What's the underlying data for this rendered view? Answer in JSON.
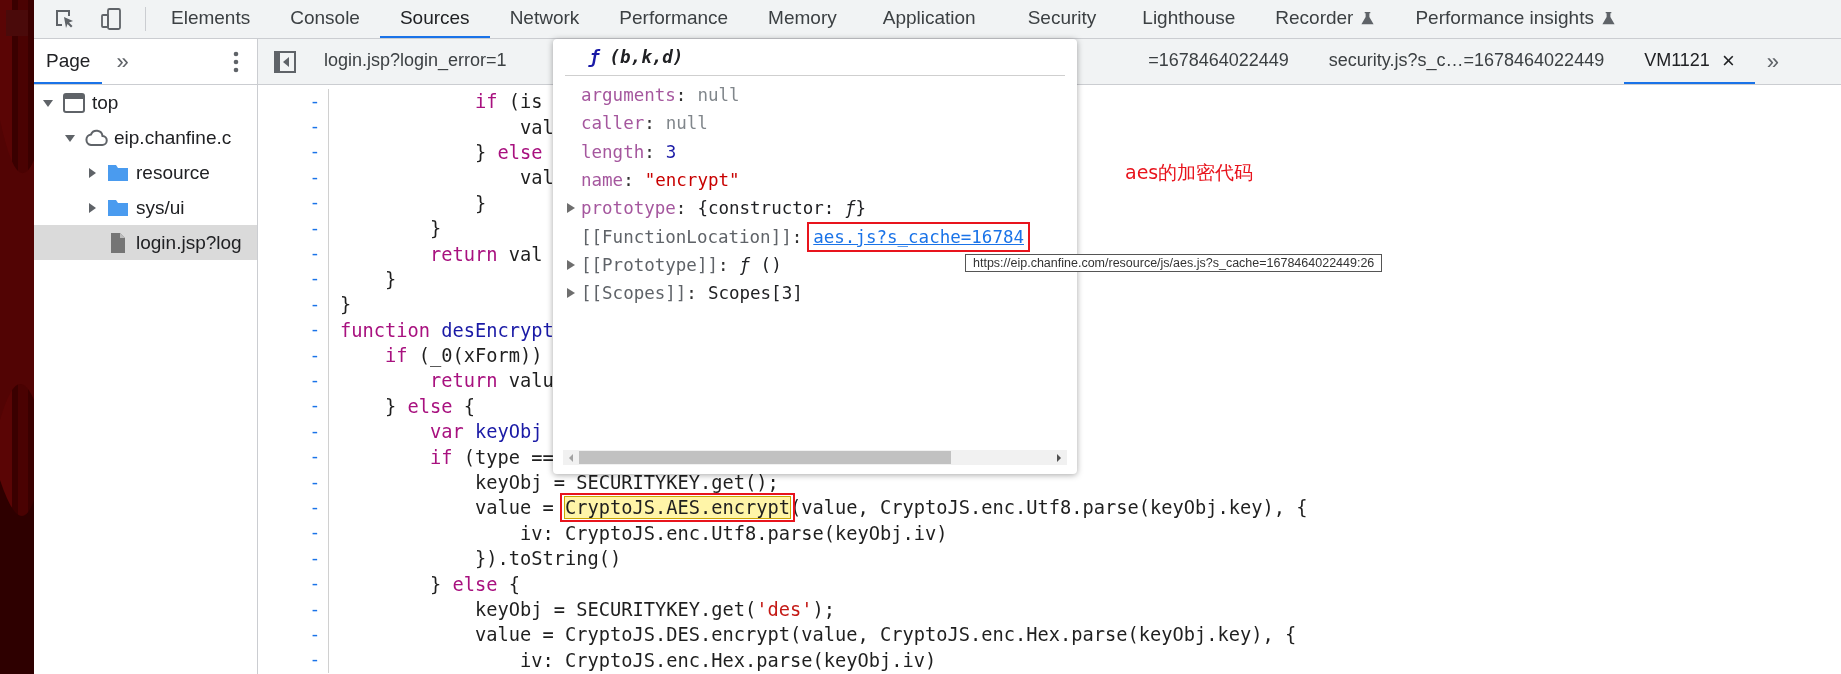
{
  "panel_tabs": [
    {
      "label": "Elements",
      "selected": false,
      "experimental": false
    },
    {
      "label": "Console",
      "selected": false,
      "experimental": false
    },
    {
      "label": "Sources",
      "selected": true,
      "experimental": false
    },
    {
      "label": "Network",
      "selected": false,
      "experimental": false
    },
    {
      "label": "Performance",
      "selected": false,
      "experimental": false
    },
    {
      "label": "Memory",
      "selected": false,
      "experimental": false
    },
    {
      "label": "Application",
      "selected": false,
      "experimental": false
    },
    {
      "label": "Security",
      "selected": false,
      "experimental": false
    },
    {
      "label": "Lighthouse",
      "selected": false,
      "experimental": false
    },
    {
      "label": "Recorder",
      "selected": false,
      "experimental": true
    },
    {
      "label": "Performance insights",
      "selected": false,
      "experimental": true
    }
  ],
  "navigator": {
    "tabs": [
      {
        "label": "Page",
        "selected": true
      }
    ],
    "more": "»",
    "tree": [
      {
        "label": "top",
        "kind": "frame",
        "expanded": true,
        "selected": false,
        "children": [
          {
            "label": "eip.chanfine.c",
            "kind": "domain",
            "expanded": true,
            "selected": false,
            "children": [
              {
                "label": "resource",
                "kind": "folder",
                "expanded": false,
                "selected": false
              },
              {
                "label": "sys/ui",
                "kind": "folder",
                "expanded": false,
                "selected": false
              },
              {
                "label": "login.jsp?log",
                "kind": "file",
                "selected": true
              }
            ]
          }
        ]
      }
    ]
  },
  "editor": {
    "tabs": [
      {
        "label": "login.jsp?login_error=1",
        "selected": false,
        "closable": false
      },
      {
        "label": "=1678464022449",
        "selected": false,
        "closable": false
      },
      {
        "label": "security.js?s_c…=1678464022449",
        "selected": false,
        "closable": false
      },
      {
        "label": "VM1121",
        "selected": true,
        "closable": true,
        "close": "×"
      }
    ],
    "more": "»",
    "lines": [
      {
        "marker": "-",
        "tokens": [
          {
            "kind": "keyword",
            "text": "            if"
          },
          {
            "kind": "plain",
            "text": " (is"
          }
        ]
      },
      {
        "marker": "-",
        "tokens": [
          {
            "kind": "plain",
            "text": "                val"
          }
        ]
      },
      {
        "marker": "-",
        "tokens": [
          {
            "kind": "plain",
            "text": "            }"
          },
          {
            "kind": "keyword",
            "text": " else"
          }
        ]
      },
      {
        "marker": "-",
        "tokens": [
          {
            "kind": "plain",
            "text": "                val"
          }
        ]
      },
      {
        "marker": "-",
        "tokens": [
          {
            "kind": "plain",
            "text": "            }"
          }
        ]
      },
      {
        "marker": "-",
        "tokens": [
          {
            "kind": "plain",
            "text": "        }"
          }
        ]
      },
      {
        "marker": "-",
        "tokens": [
          {
            "kind": "keyword",
            "text": "        return"
          },
          {
            "kind": "plain",
            "text": " val"
          }
        ]
      },
      {
        "marker": "-",
        "tokens": [
          {
            "kind": "plain",
            "text": "    }"
          }
        ]
      },
      {
        "marker": "-",
        "tokens": [
          {
            "kind": "plain",
            "text": "}"
          }
        ]
      },
      {
        "marker": "-",
        "tokens": [
          {
            "kind": "keyword",
            "text": "function"
          },
          {
            "kind": "definition",
            "text": " desEncrypt"
          }
        ]
      },
      {
        "marker": "-",
        "tokens": [
          {
            "kind": "keyword",
            "text": "    if"
          },
          {
            "kind": "plain",
            "text": " (_0(xForm))"
          }
        ]
      },
      {
        "marker": "-",
        "tokens": [
          {
            "kind": "keyword",
            "text": "        return"
          },
          {
            "kind": "plain",
            "text": " valu"
          }
        ]
      },
      {
        "marker": "-",
        "tokens": [
          {
            "kind": "plain",
            "text": "    }"
          },
          {
            "kind": "keyword",
            "text": " else"
          },
          {
            "kind": "plain",
            "text": " {"
          }
        ]
      },
      {
        "marker": "-",
        "tokens": [
          {
            "kind": "keyword",
            "text": "        var"
          },
          {
            "kind": "definition",
            "text": " keyObj"
          }
        ]
      },
      {
        "marker": "-",
        "tokens": [
          {
            "kind": "keyword",
            "text": "        if"
          },
          {
            "kind": "plain",
            "text": " (type =="
          }
        ]
      },
      {
        "marker": "-",
        "tokens": [
          {
            "kind": "plain",
            "text": "            keyObj = SECURITYKEY.get();"
          }
        ]
      },
      {
        "marker": "-",
        "tokens": [
          {
            "kind": "plain",
            "text": "            value ="
          },
          {
            "kind": "highlight",
            "text": "CryptoJS.AES.encrypt"
          },
          {
            "kind": "plain",
            "text": "(value, CryptoJS.enc.Utf8.parse(keyObj.key), {"
          }
        ]
      },
      {
        "marker": "-",
        "tokens": [
          {
            "kind": "plain",
            "text": "                iv: CryptoJS.enc.Utf8.parse(keyObj.iv)"
          }
        ]
      },
      {
        "marker": "-",
        "tokens": [
          {
            "kind": "plain",
            "text": "            }).toString()"
          }
        ]
      },
      {
        "marker": "-",
        "tokens": [
          {
            "kind": "plain",
            "text": "        }"
          },
          {
            "kind": "keyword",
            "text": " else"
          },
          {
            "kind": "plain",
            "text": " {"
          }
        ]
      },
      {
        "marker": "-",
        "tokens": [
          {
            "kind": "plain",
            "text": "            keyObj = SECURITYKEY.get("
          },
          {
            "kind": "string",
            "text": "'des'"
          },
          {
            "kind": "plain",
            "text": ");"
          }
        ]
      },
      {
        "marker": "-",
        "tokens": [
          {
            "kind": "plain",
            "text": "            value = CryptoJS.DES.encrypt(value, CryptoJS.enc.Hex.parse(keyObj.key), {"
          }
        ]
      },
      {
        "marker": "-",
        "tokens": [
          {
            "kind": "plain",
            "text": "                iv: CryptoJS.enc.Hex.parse(keyObj.iv)"
          }
        ]
      }
    ]
  },
  "popup": {
    "glyph": "ƒ",
    "signature": "(b,k,d)",
    "properties": [
      {
        "key": "arguments",
        "separator": ":",
        "value": "null",
        "kind": "null",
        "internal": false
      },
      {
        "key": "caller",
        "separator": ":",
        "value": "null",
        "kind": "null",
        "internal": false
      },
      {
        "key": "length",
        "separator": ":",
        "value": "3",
        "kind": "number",
        "internal": false
      },
      {
        "key": "name",
        "separator": ":",
        "value": "\"encrypt\"",
        "kind": "string",
        "internal": false
      },
      {
        "key": "prototype",
        "separator": ":",
        "value": "{constructor: *ƒ*}",
        "kind": "object",
        "internal": false,
        "expanded": false
      },
      {
        "key": "[[FunctionLocation]]",
        "separator": ":",
        "value": "aes.js?s_cache=16784",
        "kind": "link",
        "internal": true
      },
      {
        "key": "[[Prototype]]",
        "separator": ":",
        "value": "*ƒ* ()",
        "kind": "function",
        "internal": true,
        "expanded": false
      },
      {
        "key": "[[Scopes]]",
        "separator": ":",
        "value": "Scopes[3]",
        "kind": "object",
        "internal": true,
        "expanded": false
      }
    ]
  },
  "tooltip": "https://eip.chanfine.com/resource/js/aes.js?s_cache=1678464022449:26",
  "annotation": "aes的加密代码"
}
